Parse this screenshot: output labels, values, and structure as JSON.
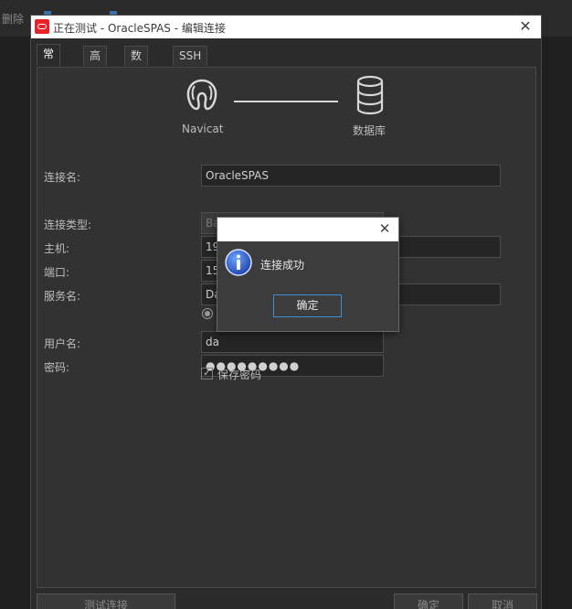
{
  "background": {
    "toolbar_text": "删除"
  },
  "window": {
    "title": "正在测试 - OracleSPAS - 编辑连接",
    "close_icon": "close-icon"
  },
  "tabs": [
    {
      "label": "常规",
      "active": true
    },
    {
      "label": "高级",
      "active": false
    },
    {
      "label": "数据库",
      "active": false
    },
    {
      "label": "SSH",
      "active": false
    }
  ],
  "graphic": {
    "left_caption": "Navicat",
    "right_caption": "数据库"
  },
  "form": {
    "conn_name_label": "连接名:",
    "conn_name_value": "OracleSPAS",
    "conn_type_label": "连接类型:",
    "conn_type_value": "Basic",
    "host_label": "主机:",
    "host_value": "19",
    "port_label": "端口:",
    "port_value": "15",
    "service_label": "服务名:",
    "service_value": "Da",
    "user_label": "用户名:",
    "user_value": "da",
    "password_label": "密码:",
    "password_value": "●●●●●●●●●",
    "save_password_label": "保存密码",
    "save_password_checked": true
  },
  "buttons": {
    "test": "测试连接",
    "ok": "确定",
    "cancel": "取消"
  },
  "dialog": {
    "message": "连接成功",
    "ok_label": "确定",
    "icon": "info-icon"
  },
  "colors": {
    "accent": "#3c8fd0",
    "oracle_red": "#e8232a"
  }
}
